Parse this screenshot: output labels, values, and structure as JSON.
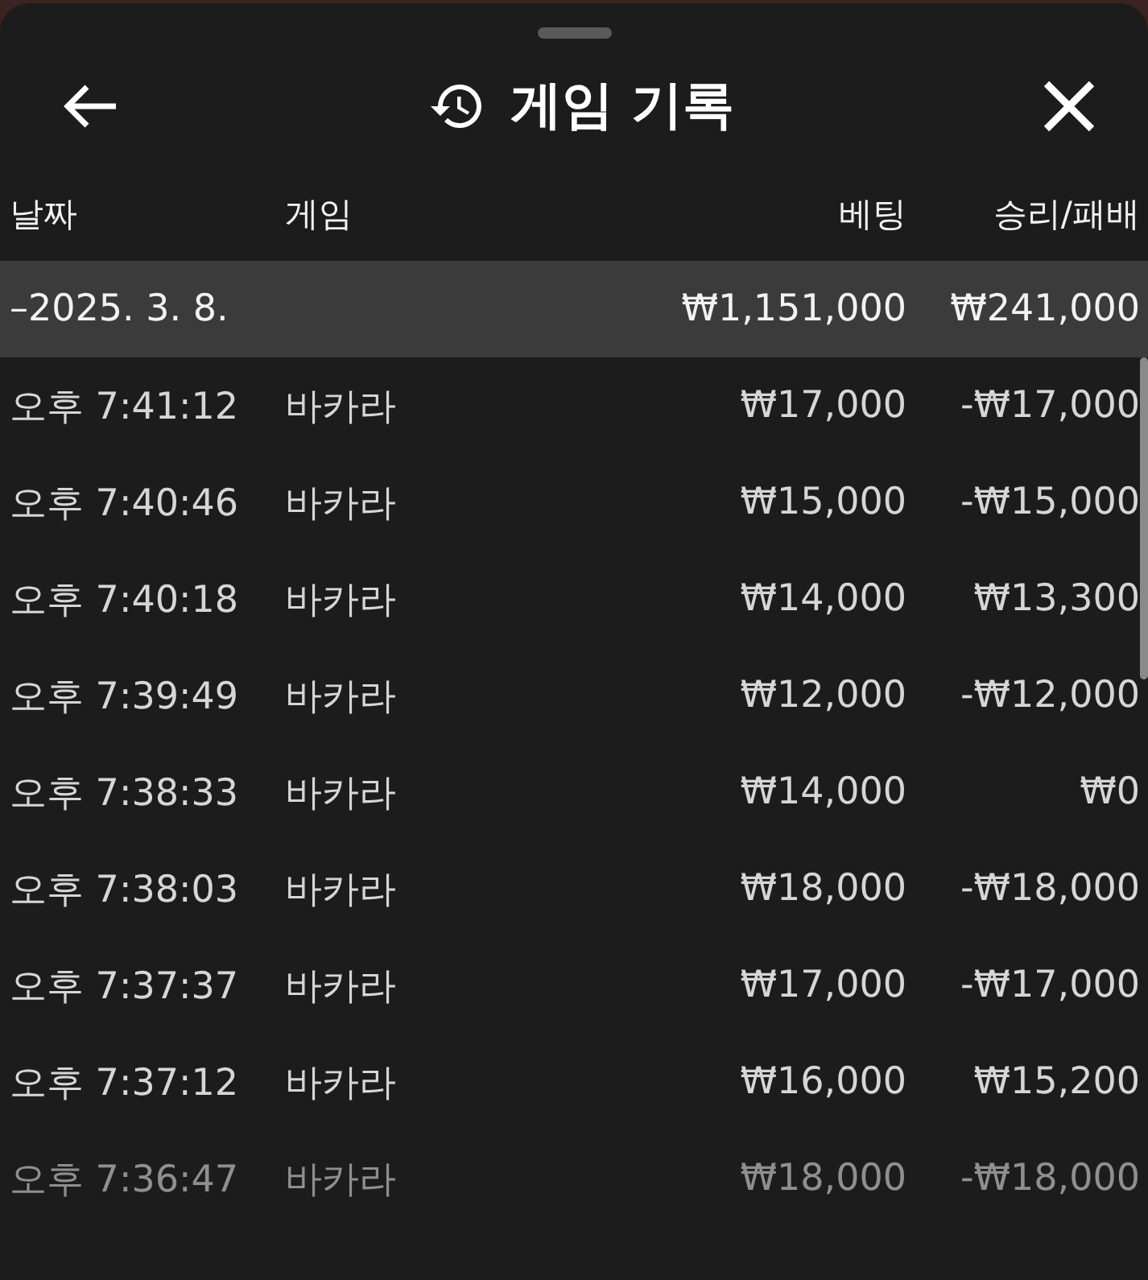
{
  "header": {
    "title": "게임 기록"
  },
  "table": {
    "columns": [
      "날짜",
      "게임",
      "베팅",
      "승리/패배"
    ],
    "summary": {
      "date": "–2025. 3. 8.",
      "bet": "₩1,151,000",
      "result": "₩241,000"
    },
    "rows": [
      {
        "time": "오후 7:41:12",
        "game": "바카라",
        "bet": "₩17,000",
        "result": "-₩17,000"
      },
      {
        "time": "오후 7:40:46",
        "game": "바카라",
        "bet": "₩15,000",
        "result": "-₩15,000"
      },
      {
        "time": "오후 7:40:18",
        "game": "바카라",
        "bet": "₩14,000",
        "result": "₩13,300"
      },
      {
        "time": "오후 7:39:49",
        "game": "바카라",
        "bet": "₩12,000",
        "result": "-₩12,000"
      },
      {
        "time": "오후 7:38:33",
        "game": "바카라",
        "bet": "₩14,000",
        "result": "₩0"
      },
      {
        "time": "오후 7:38:03",
        "game": "바카라",
        "bet": "₩18,000",
        "result": "-₩18,000"
      },
      {
        "time": "오후 7:37:37",
        "game": "바카라",
        "bet": "₩17,000",
        "result": "-₩17,000"
      },
      {
        "time": "오후 7:37:12",
        "game": "바카라",
        "bet": "₩16,000",
        "result": "₩15,200"
      },
      {
        "time": "오후 7:36:47",
        "game": "바카라",
        "bet": "₩18,000",
        "result": "-₩18,000"
      }
    ]
  }
}
